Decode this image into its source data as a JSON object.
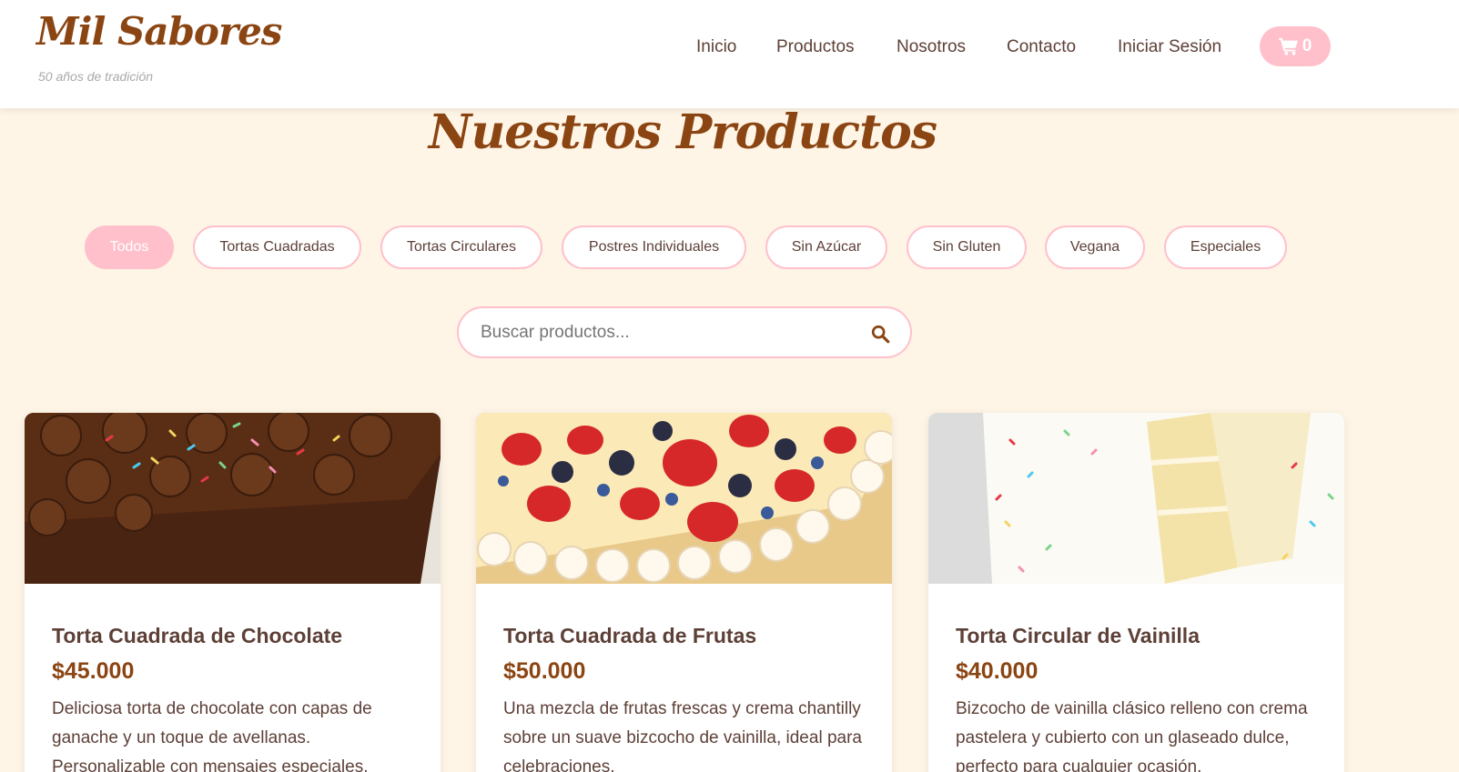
{
  "header": {
    "brand": "Mil Sabores",
    "tagline": "50 años de tradición",
    "nav": [
      "Inicio",
      "Productos",
      "Nosotros",
      "Contacto",
      "Iniciar Sesión"
    ],
    "cart_count": "0"
  },
  "page": {
    "title": "Nuestros Productos"
  },
  "filters": {
    "items": [
      "Todos",
      "Tortas Cuadradas",
      "Tortas Circulares",
      "Postres Individuales",
      "Sin Azúcar",
      "Sin Gluten",
      "Vegana",
      "Especiales"
    ],
    "active": "Todos"
  },
  "search": {
    "placeholder": "Buscar productos..."
  },
  "products": [
    {
      "name": "Torta Cuadrada de Chocolate",
      "price": "$45.000",
      "description": "Deliciosa torta de chocolate con capas de ganache y un toque de avellanas. Personalizable con mensajes especiales."
    },
    {
      "name": "Torta Cuadrada de Frutas",
      "price": "$50.000",
      "description": "Una mezcla de frutas frescas y crema chantilly sobre un suave bizcocho de vainilla, ideal para celebraciones."
    },
    {
      "name": "Torta Circular de Vainilla",
      "price": "$40.000",
      "description": "Bizcocho de vainilla clásico relleno con crema pastelera y cubierto con un glaseado dulce, perfecto para cualquier ocasión."
    }
  ],
  "colors": {
    "brand": "#8b4513",
    "accent": "#ffc0cb",
    "background": "#fff5e6",
    "text": "#5d4037"
  }
}
